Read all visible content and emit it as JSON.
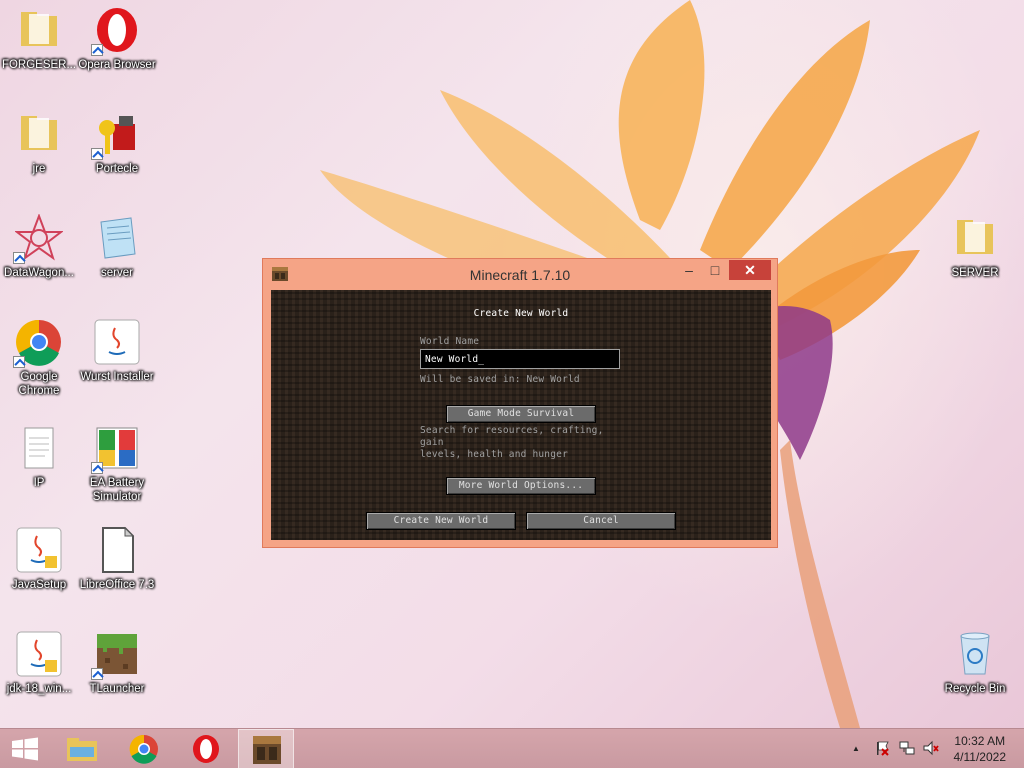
{
  "desktop_icons": [
    {
      "id": "forge",
      "label": "FORGESER..."
    },
    {
      "id": "opera",
      "label": "Opera Browser"
    },
    {
      "id": "jre",
      "label": "jre"
    },
    {
      "id": "portecle",
      "label": "Portecle"
    },
    {
      "id": "datawagon",
      "label": "DataWagon..."
    },
    {
      "id": "server",
      "label": "server"
    },
    {
      "id": "chrome",
      "label": "Google Chrome"
    },
    {
      "id": "wurst",
      "label": "Wurst Installer"
    },
    {
      "id": "ip",
      "label": "IP"
    },
    {
      "id": "ea",
      "label": "EA Battery Simulator"
    },
    {
      "id": "javasetup",
      "label": "JavaSetup"
    },
    {
      "id": "libreoffice",
      "label": "LibreOffice 7.3"
    },
    {
      "id": "jdk",
      "label": "jdk-18_win..."
    },
    {
      "id": "tlauncher",
      "label": "TLauncher"
    },
    {
      "id": "serverfolder",
      "label": "SERVER"
    },
    {
      "id": "recycle",
      "label": "Recycle Bin"
    }
  ],
  "window": {
    "title": "Minecraft 1.7.10",
    "min_symbol": "–",
    "max_symbol": "□",
    "close_symbol": "✕"
  },
  "minecraft": {
    "screen_title": "Create New World",
    "world_name_label": "World Name",
    "world_name_value": "New World_",
    "saved_in": "Will be saved in: New World",
    "game_mode_button": "Game Mode Survival",
    "game_mode_desc_line1": "Search for resources, crafting, gain",
    "game_mode_desc_line2": "levels, health and hunger",
    "more_options_button": "More World Options...",
    "create_button": "Create New World",
    "cancel_button": "Cancel"
  },
  "taskbar": {
    "time": "10:32 AM",
    "date": "4/11/2022",
    "tray_up_arrow": "▲"
  },
  "colors": {
    "window_frame": "#f5a486",
    "close_button": "#c7423a",
    "taskbar": "#d5a5ab"
  }
}
